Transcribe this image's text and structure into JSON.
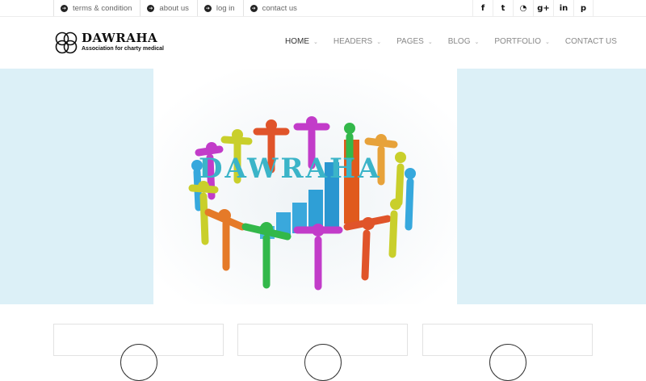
{
  "topbar": {
    "links": [
      {
        "label": "terms & condition"
      },
      {
        "label": "about us"
      },
      {
        "label": "log in"
      },
      {
        "label": "contact us"
      }
    ],
    "social_icons": [
      "facebook-icon",
      "twitter-icon",
      "rss-icon",
      "google-plus-icon",
      "linkedin-icon",
      "pinterest-icon"
    ],
    "social_glyphs": [
      "f",
      "t",
      "◔",
      "g+",
      "in",
      "p"
    ]
  },
  "logo": {
    "title": "DAWRAHA",
    "subtitle": "Association for charty medical"
  },
  "nav": {
    "items": [
      {
        "label": "HOME",
        "has_dropdown": true
      },
      {
        "label": "HEADERS",
        "has_dropdown": true
      },
      {
        "label": "PAGES",
        "has_dropdown": true
      },
      {
        "label": "BLOG",
        "has_dropdown": true
      },
      {
        "label": "PORTFOLIO",
        "has_dropdown": true
      },
      {
        "label": "CONTACT US",
        "has_dropdown": false
      }
    ]
  },
  "hero": {
    "title": "DAWRAHA",
    "title_color": "#3bb4c8",
    "background": "#dcf0f7"
  }
}
